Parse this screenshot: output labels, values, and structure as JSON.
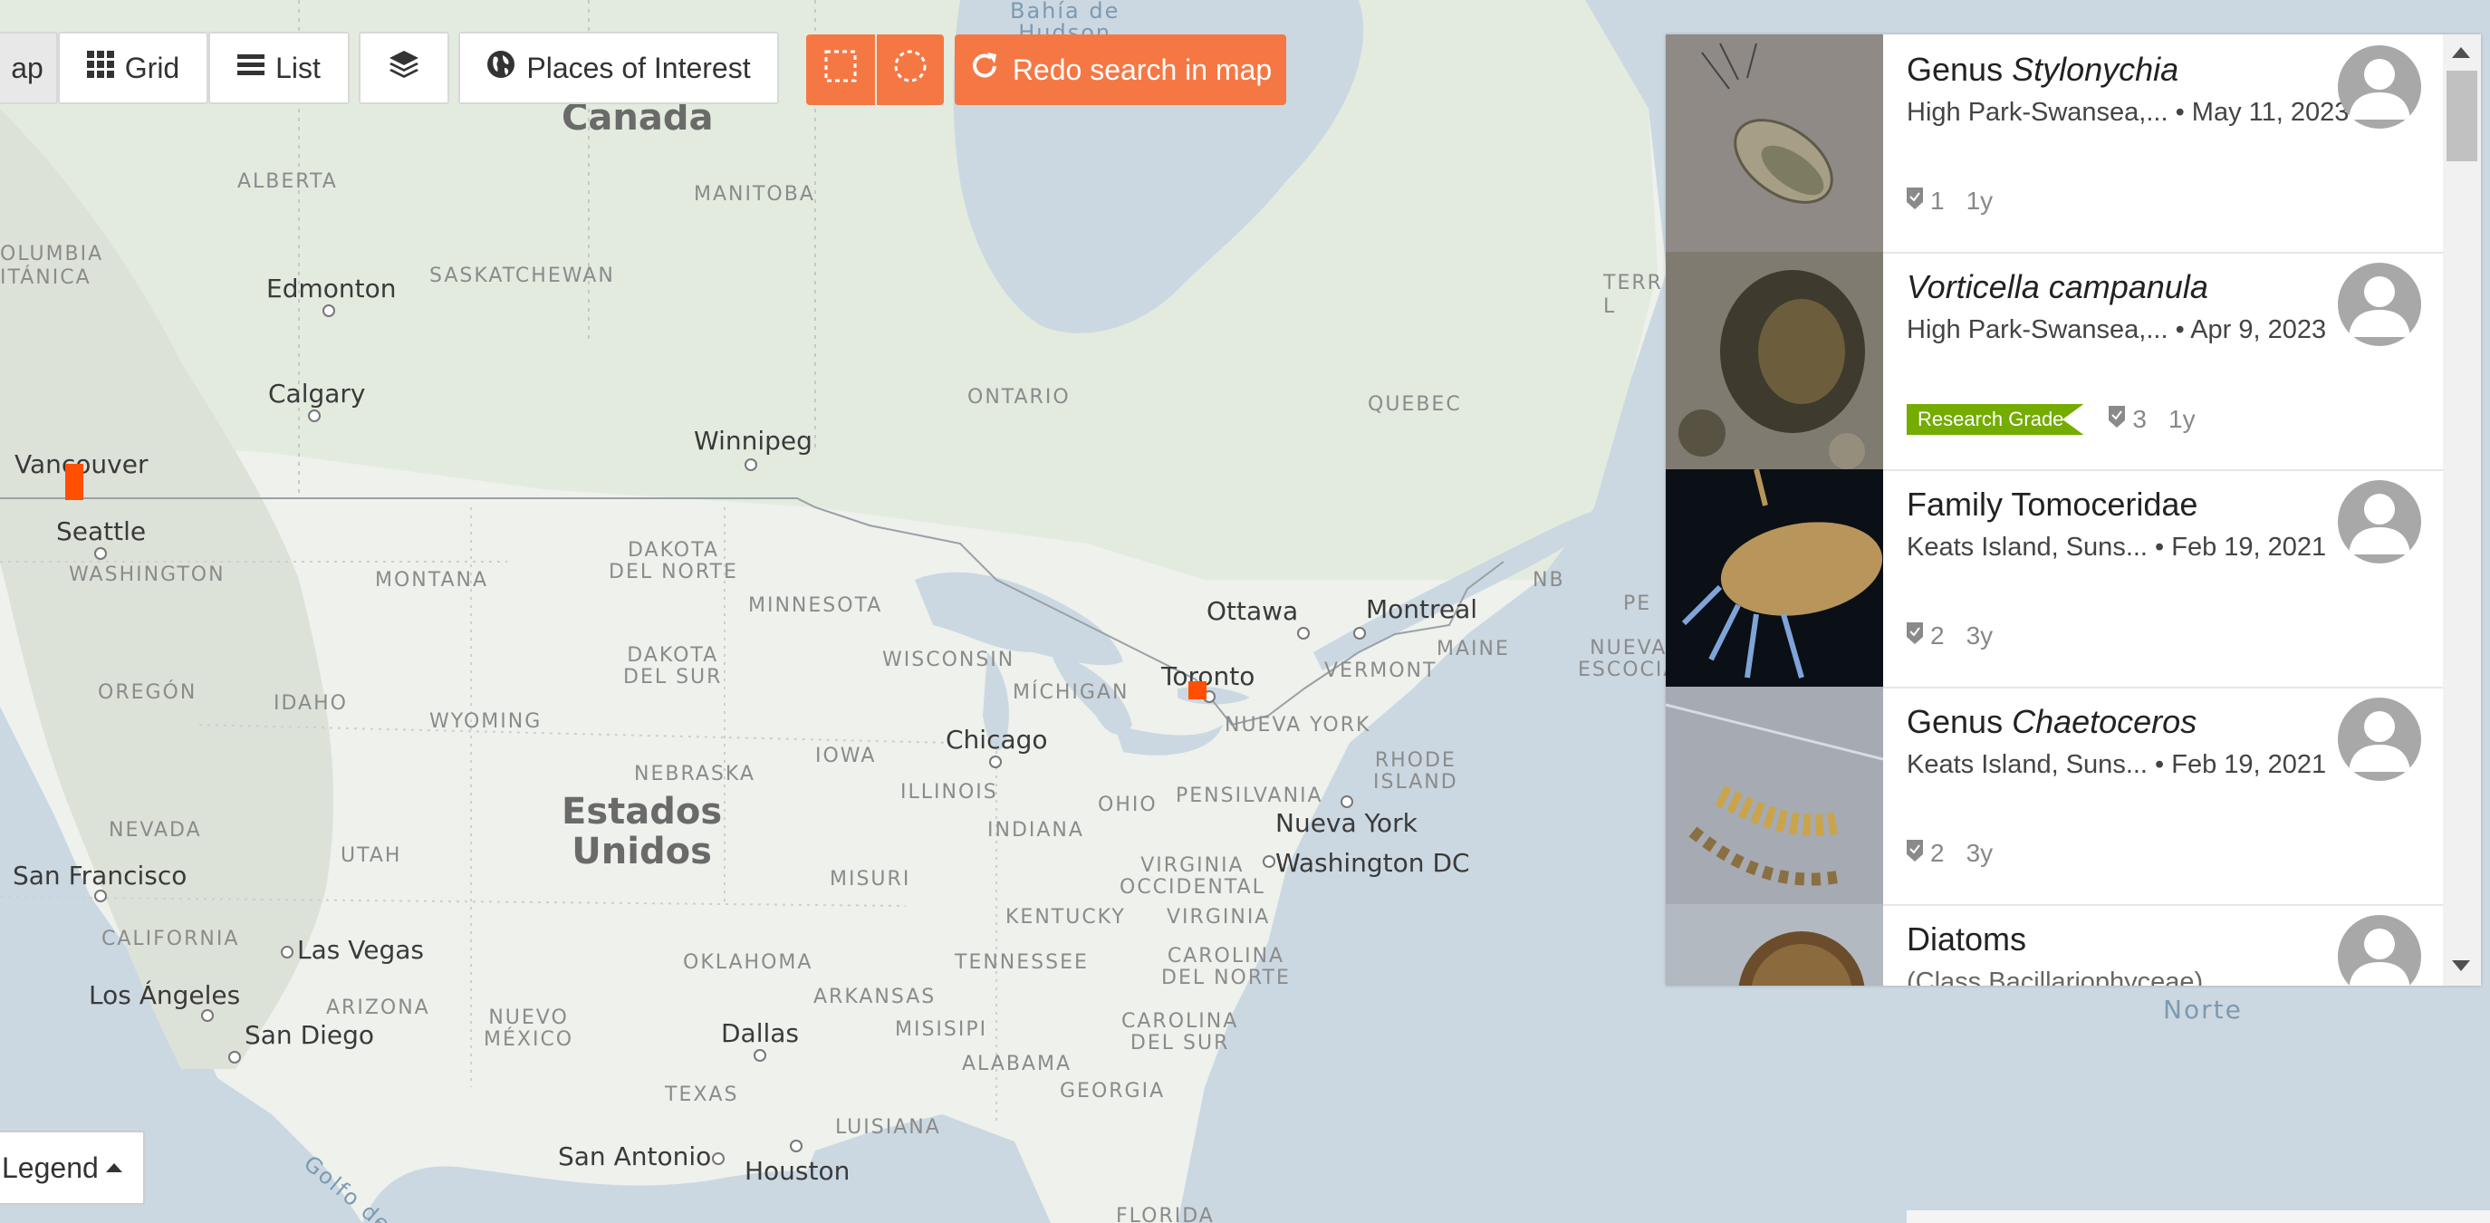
{
  "toolbar": {
    "map_label": "ap",
    "grid_label": "Grid",
    "list_label": "List",
    "places_label": "Places of Interest",
    "redo_label": "Redo search in map"
  },
  "map_labels": {
    "canada": "Canada",
    "estados": "Estados\nUnidos",
    "alberta": "ALBERTA",
    "manitoba": "MANITOBA",
    "saskatchewan": "SASKATCHEWAN",
    "ontario": "ONTARIO",
    "quebec": "QUEBEC",
    "bc": "OLUMBIA\nITÁNICA",
    "terr": "TERR\nL",
    "edmonton": "Edmonton",
    "calgary": "Calgary",
    "winnipeg": "Winnipeg",
    "vancouver": "Vancouver",
    "seattle": "Seattle",
    "washington": "WASHINGTON",
    "montana": "MONTANA",
    "dakota_norte": "DAKOTA\nDEL NORTE",
    "dakota_sur": "DAKOTA\nDEL SUR",
    "minnesota": "MINNESOTA",
    "wisconsin": "WISCONSIN",
    "michigan": "MÍCHIGAN",
    "ottawa": "Ottawa",
    "montreal": "Montreal",
    "toronto": "Toronto",
    "nb": "NB",
    "pe": "PE",
    "maine": "MAINE",
    "vermont": "VERMONT",
    "nueva_escocia": "NUEVA\nESCOCIA",
    "oregon": "OREGÓN",
    "idaho": "IDAHO",
    "wyoming": "WYOMING",
    "nebraska": "NEBRASKA",
    "iowa": "IOWA",
    "illinois": "ILLINOIS",
    "chicago": "Chicago",
    "ohio": "OHIO",
    "indiana": "INDIANA",
    "pensilvania": "PENSILVANIA",
    "nueva_york_state": "NUEVA YORK",
    "rhode": "RHODE\nISLAND",
    "nueva_york": "Nueva York",
    "washington_dc": "Washington DC",
    "nevada": "NEVADA",
    "utah": "UTAH",
    "san_francisco": "San Francisco",
    "california": "CALIFORNIA",
    "las_vegas": "Las Vegas",
    "arizona": "ARIZONA",
    "los_angeles": "Los Ángeles",
    "san_diego": "San Diego",
    "nuevo_mexico": "NUEVO\nMÉXICO",
    "oklahoma": "OKLAHOMA",
    "misuri": "MISURI",
    "kentucky": "KENTUCKY",
    "virginia_occ": "VIRGINIA\nOCCIDENTAL",
    "virginia": "VIRGINIA",
    "tennessee": "TENNESSEE",
    "arkansas": "ARKANSAS",
    "carolina_norte": "CAROLINA\nDEL NORTE",
    "carolina_sur": "CAROLINA\nDEL SUR",
    "misisipi": "MISISIPI",
    "alabama": "ALABAMA",
    "georgia": "GEORGIA",
    "dallas": "Dallas",
    "texas": "TEXAS",
    "luisiana": "LUISIANA",
    "san_antonio": "San Antonio",
    "houston": "Houston",
    "florida": "FLORIDA",
    "bahia": "Bahía de\nHudson",
    "golfo": "Golfo de",
    "norte": "Norte"
  },
  "observations": [
    {
      "title_prefix": "Genus ",
      "title_italic": "Stylonychia",
      "place": "High Park-Swansea,...",
      "date": "May 11, 2023",
      "ids": "1",
      "age": "1y",
      "badge": ""
    },
    {
      "title_prefix": "",
      "title_italic": "Vorticella campanula",
      "place": "High Park-Swansea,...",
      "date": "Apr 9, 2023",
      "ids": "3",
      "age": "1y",
      "badge": "Research Grade"
    },
    {
      "title_prefix": "Family Tomoceridae",
      "title_italic": "",
      "place": "Keats Island, Suns...",
      "date": "Feb 19, 2021",
      "ids": "2",
      "age": "3y",
      "badge": ""
    },
    {
      "title_prefix": "Genus ",
      "title_italic": "Chaetoceros",
      "place": "Keats Island, Suns...",
      "date": "Feb 19, 2021",
      "ids": "2",
      "age": "3y",
      "badge": ""
    },
    {
      "title_prefix": "Diatoms",
      "title_italic": "",
      "place": "(Class Bacillariophyceae)",
      "date": "",
      "ids": "",
      "age": "",
      "badge": ""
    }
  ],
  "legend": {
    "label": "Legend"
  },
  "colors": {
    "accent": "#f57844",
    "marker": "#ff4f00",
    "research_grade": "#74ac00"
  }
}
